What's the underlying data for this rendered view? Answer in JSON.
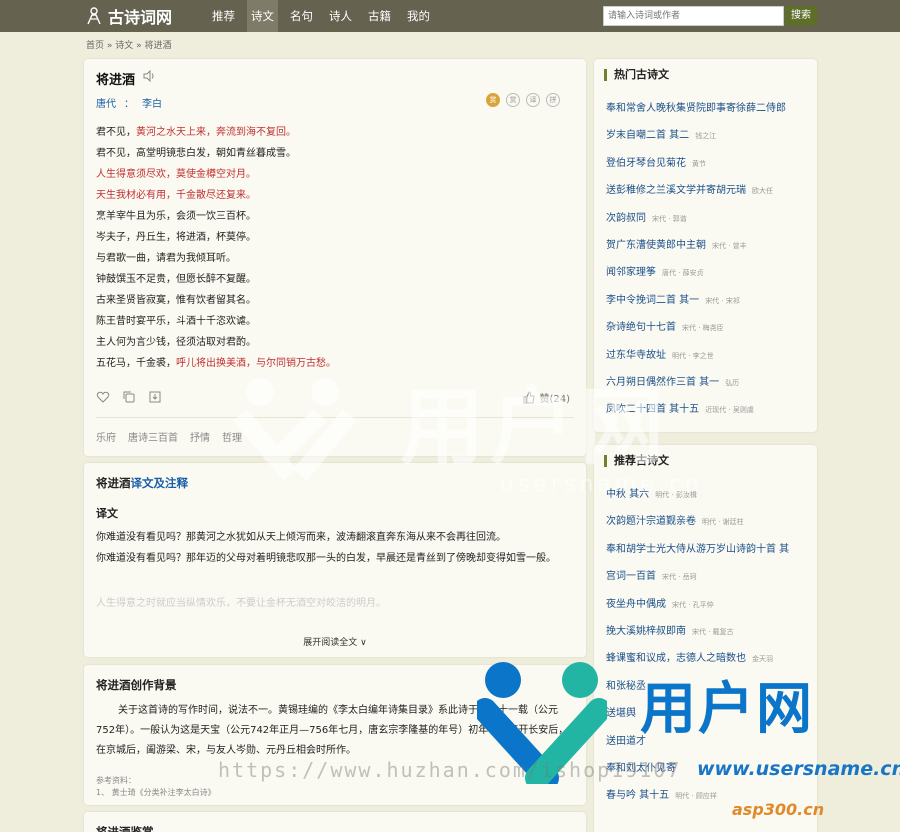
{
  "header": {
    "logo_text": "古诗词网",
    "nav": [
      "推荐",
      "诗文",
      "名句",
      "诗人",
      "古籍",
      "我的"
    ],
    "search_placeholder": "请输入诗词或作者",
    "search_button": "搜索"
  },
  "breadcrumb": "首页 » 诗文 » 将进酒",
  "poem": {
    "title": "将进酒",
    "dynasty": "唐代",
    "separator": "：",
    "author": "李白",
    "badges": [
      "赏",
      "赏",
      "译",
      "拼"
    ],
    "lines": [
      {
        "a": "君不见，",
        "b": "黄河之水天上来，奔流到海不复回。",
        "hl": "b"
      },
      {
        "a": "君不见，高堂明镜悲白发，朝如青丝暮成雪。",
        "b": "",
        "hl": ""
      },
      {
        "a": "人生得意须尽欢，莫使金樽空对月。",
        "b": "",
        "hl": "a"
      },
      {
        "a": "天生我材必有用，千金散尽还复来。",
        "b": "",
        "hl": "a"
      },
      {
        "a": "烹羊宰牛且为乐，会须一饮三百杯。",
        "b": "",
        "hl": ""
      },
      {
        "a": "岑夫子，丹丘生，将进酒，杯莫停。",
        "b": "",
        "hl": ""
      },
      {
        "a": "与君歌一曲，请君为我倾耳听。",
        "b": "",
        "hl": ""
      },
      {
        "a": "钟鼓馔玉不足贵，但愿长醉不复醒。",
        "b": "",
        "hl": ""
      },
      {
        "a": "古来圣贤皆寂寞，惟有饮者留其名。",
        "b": "",
        "hl": ""
      },
      {
        "a": "陈王昔时宴平乐，斗酒十千恣欢谑。",
        "b": "",
        "hl": ""
      },
      {
        "a": "主人何为言少钱，径须沽取对君酌。",
        "b": "",
        "hl": ""
      },
      {
        "a": "五花马，千金裘，",
        "b": "呼儿将出换美酒，与尔同销万古愁。",
        "hl": "b"
      }
    ],
    "like_label": "赞(24)",
    "tags": [
      "乐府",
      "唐诗三百首",
      "抒情",
      "哲理"
    ]
  },
  "translation": {
    "title_a": "将进酒",
    "title_b": "译文及注释",
    "sub": "译文",
    "paras": [
      "你难道没有看见吗？那黄河之水犹如从天上倾泻而来，波涛翻滚直奔东海从来不会再往回流。",
      "你难道没有看见吗？那年迈的父母对着明镜悲叹那一头的白发，早晨还是青丝到了傍晚却变得如雪一般。"
    ],
    "faded": "人生得意之时就应当纵情欢乐，不要让金杯无酒空对皎洁的明月。",
    "more": "展开阅读全文 ∨"
  },
  "background": {
    "title": "将进酒创作背景",
    "text": "关于这首诗的写作时间，说法不一。黄锡珪编的《李太白编年诗集目录》系此诗于天宝十一载（公元752年）。一般认为这是天宝（公元742年正月—756年七月，唐玄宗李隆基的年号）初年李白离开长安后，在京城后，阖游梁、宋，与友人岑勋、元丹丘相会时所作。",
    "ref_label": "参考资料：",
    "ref_item": "1、 黄士琦《分类补注李太白诗》"
  },
  "next_section": {
    "title": "将进酒鉴赏"
  },
  "sidebar_hot": {
    "title": "热门古诗文",
    "items": [
      {
        "t": "奉和常舍人晚秋集贤院即事寄徐薛二侍郎",
        "m": ""
      },
      {
        "t": "岁末自嘲二首 其二",
        "m": "钱之江"
      },
      {
        "t": "登伯牙琴台见菊花",
        "m": "黄节"
      },
      {
        "t": "送彭稚修之兰溪文学并寄胡元瑞",
        "m": "欧大任"
      },
      {
        "t": "次韵叔同",
        "m": "宋代 · 郭谐"
      },
      {
        "t": "贺广东漕使黄郎中主朝",
        "m": "宋代 · 曾丰"
      },
      {
        "t": "闻邻家理筝",
        "m": "唐代 · 薛安贞"
      },
      {
        "t": "李中令挽词二首 其一",
        "m": "宋代 · 宋祁"
      },
      {
        "t": "杂诗绝句十七首",
        "m": "宋代 · 梅尧臣"
      },
      {
        "t": "过东华寺故址",
        "m": "明代 · 李之世"
      },
      {
        "t": "六月朔日偶然作三首 其一",
        "m": "弘历"
      },
      {
        "t": "凤吹二十四首 其十五",
        "m": "近现代 · 吴则虞"
      }
    ]
  },
  "sidebar_rec": {
    "title": "推荐古诗文",
    "items": [
      {
        "t": "中秋 其六",
        "m": "明代 · 彭汝楫"
      },
      {
        "t": "次韵题汁宗道觐亲卷",
        "m": "明代 · 谢廷柱"
      },
      {
        "t": "奉和胡学士光大侍从游万岁山诗韵十首 其",
        "m": ""
      },
      {
        "t": "宫词一百首",
        "m": "宋代 · 岳珂"
      },
      {
        "t": "夜坐舟中偶成",
        "m": "宋代 · 孔平仲"
      },
      {
        "t": "挽大溪姚梓叔即南",
        "m": "宋代 · 戴复古"
      },
      {
        "t": "蜂课蜜和议成，志德人之暗数也",
        "m": "金天羽"
      },
      {
        "t": "和张秘丞",
        "m": ""
      },
      {
        "t": "送堪舆",
        "m": ""
      },
      {
        "t": "送田道才",
        "m": ""
      },
      {
        "t": "奉和刘太仆见寄",
        "m": ""
      },
      {
        "t": "春与吟 其十五",
        "m": "明代 · 顾应祥"
      }
    ]
  },
  "watermarks": {
    "center_text": "用户网",
    "center_url": "usersname.cn",
    "brand_text": "用户网",
    "brand_url": "www.usersname.cn",
    "brand_url2": "asp300.cn",
    "huzhan": "https://www.huzhan.com/ishop19107"
  }
}
